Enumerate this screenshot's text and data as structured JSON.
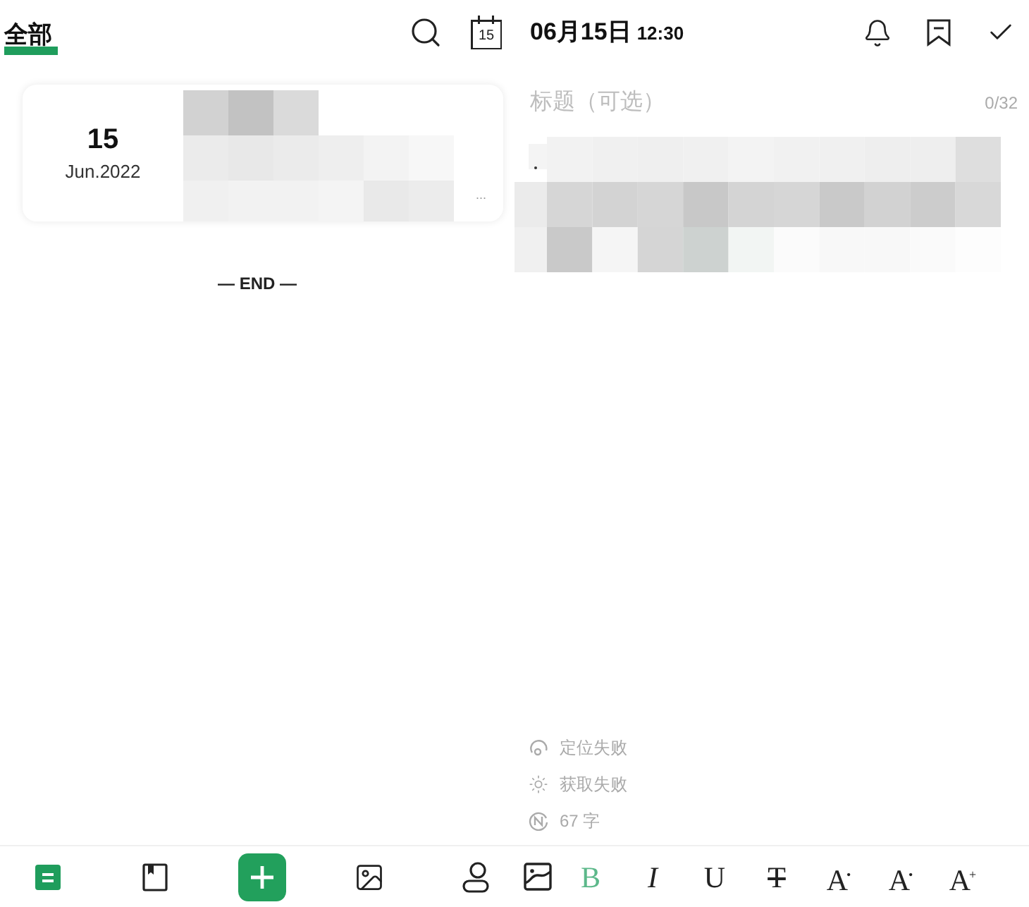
{
  "list_screen": {
    "header": {
      "tab": {
        "label": "全部",
        "selected": true
      },
      "calendar_day": "15"
    },
    "notes": [
      {
        "day": "15",
        "month_year": "Jun.2022",
        "more": "..."
      }
    ],
    "end_marker": "— END —",
    "bottom_nav": [
      {
        "kind": "notes",
        "selected": true
      },
      {
        "kind": "book",
        "selected": false
      },
      {
        "kind": "add",
        "selected": false
      },
      {
        "kind": "gallery",
        "selected": false
      },
      {
        "kind": "profile",
        "selected": false
      }
    ]
  },
  "editor_screen": {
    "header": {
      "date": "06月15日",
      "time": "12:30"
    },
    "title_field": {
      "placeholder": "标题（可选）",
      "counter": "0/32"
    },
    "meta": [
      {
        "kind": "location",
        "text": "定位失败"
      },
      {
        "kind": "weather",
        "text": "获取失败"
      },
      {
        "kind": "count",
        "text": "67 字"
      }
    ],
    "format_toolbar": [
      {
        "kind": "image",
        "selected": false
      },
      {
        "kind": "letter",
        "label": "B",
        "selected": true
      },
      {
        "kind": "italic",
        "label": "I",
        "selected": false
      },
      {
        "kind": "letter",
        "label": "U",
        "selected": false
      },
      {
        "kind": "strike",
        "label": "T",
        "selected": false
      },
      {
        "kind": "letter",
        "label": "A$^{•}$",
        "selected": false
      },
      {
        "kind": "letter",
        "label": "A$^{•}$",
        "selected": false
      },
      {
        "kind": "letter",
        "label": "A$^{+}$",
        "selected": false
      }
    ]
  }
}
